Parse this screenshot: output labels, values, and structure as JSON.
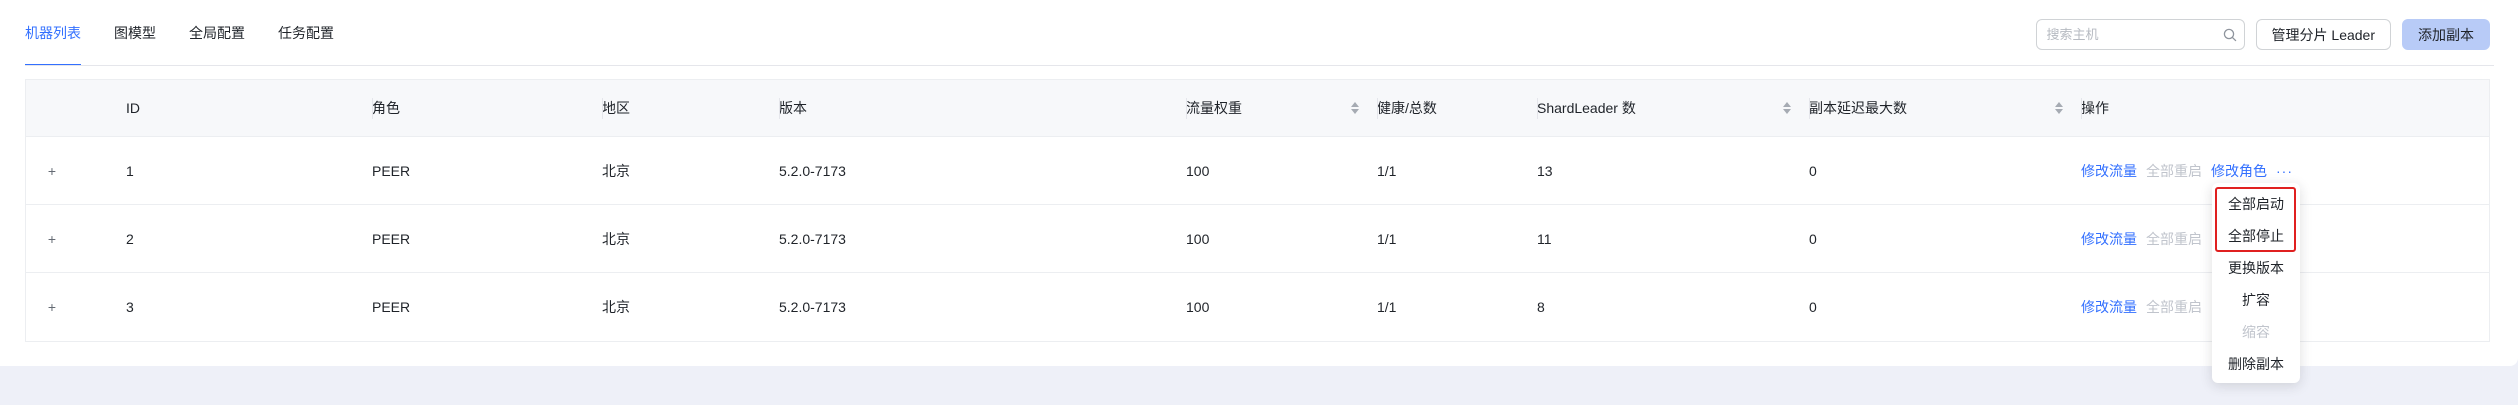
{
  "tabs": [
    {
      "label": "机器列表",
      "active": true
    },
    {
      "label": "图模型",
      "active": false
    },
    {
      "label": "全局配置",
      "active": false
    },
    {
      "label": "任务配置",
      "active": false
    }
  ],
  "toolbar": {
    "search_placeholder": "搜索主机",
    "search_value": "",
    "manage_shard_leader": "管理分片 Leader",
    "add_replica": "添加副本"
  },
  "table": {
    "columns": [
      "ID",
      "角色",
      "地区",
      "版本",
      "流量权重",
      "健康/总数",
      "ShardLeader 数",
      "副本延迟最大数",
      "操作"
    ],
    "sortable_columns": [
      "流量权重",
      "ShardLeader 数",
      "副本延迟最大数"
    ],
    "rows": [
      {
        "expand": "+",
        "id": "1",
        "role": "PEER",
        "region": "北京",
        "version": "5.2.0-7173",
        "weight": "100",
        "health": "1/1",
        "shard_leader": "13",
        "replica_delay": "0"
      },
      {
        "expand": "+",
        "id": "2",
        "role": "PEER",
        "region": "北京",
        "version": "5.2.0-7173",
        "weight": "100",
        "health": "1/1",
        "shard_leader": "11",
        "replica_delay": "0"
      },
      {
        "expand": "+",
        "id": "3",
        "role": "PEER",
        "region": "北京",
        "version": "5.2.0-7173",
        "weight": "100",
        "health": "1/1",
        "shard_leader": "8",
        "replica_delay": "0"
      }
    ],
    "ops": {
      "modify_traffic": "修改流量",
      "restart_all": "全部重启",
      "modify_role": "修改角色",
      "more": "···"
    }
  },
  "dropdown": {
    "items": [
      {
        "label": "全部启动",
        "disabled": false
      },
      {
        "label": "全部停止",
        "disabled": false
      },
      {
        "label": "更换版本",
        "disabled": false
      },
      {
        "label": "扩容",
        "disabled": false
      },
      {
        "label": "缩容",
        "disabled": true
      },
      {
        "label": "删除副本",
        "disabled": false
      }
    ]
  },
  "colors": {
    "accent": "#3370ff",
    "highlight": "#e02020",
    "disabled_text": "#c0c4cc",
    "page_bg": "#eef0f8"
  }
}
